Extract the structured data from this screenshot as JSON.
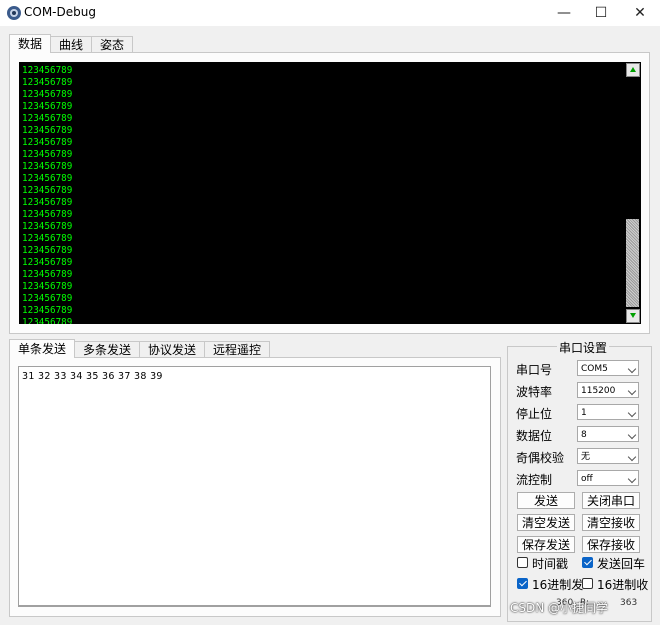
{
  "window": {
    "title": "COM-Debug",
    "minimize": "—",
    "maximize": "☐",
    "close": "✕"
  },
  "top_tabs": [
    "数据",
    "曲线",
    "姿态"
  ],
  "console": {
    "lines": [
      "123456789",
      "123456789",
      "123456789",
      "123456789",
      "123456789",
      "123456789",
      "123456789",
      "123456789",
      "123456789",
      "123456789",
      "123456789",
      "123456789",
      "123456789",
      "123456789",
      "123456789",
      "123456789",
      "123456789",
      "123456789",
      "123456789",
      "123456789",
      "123456789",
      "123456789"
    ]
  },
  "bottom_tabs": [
    "单条发送",
    "多条发送",
    "协议发送",
    "远程遥控"
  ],
  "send": {
    "text": "31 32 33 34 35 36 37 38 39"
  },
  "serial": {
    "title": "串口设置",
    "fields": [
      {
        "label": "串口号",
        "value": "COM5"
      },
      {
        "label": "波特率",
        "value": "115200"
      },
      {
        "label": "停止位",
        "value": "1"
      },
      {
        "label": "数据位",
        "value": "8"
      },
      {
        "label": "奇偶校验",
        "value": "无"
      },
      {
        "label": "流控制",
        "value": "off"
      }
    ],
    "buttons": {
      "send": "发送",
      "close_port": "关闭串口",
      "clear_send": "清空发送",
      "clear_recv": "清空接收",
      "save_send": "保存发送",
      "save_recv": "保存接收"
    },
    "checks": {
      "timestamp": "时间戳",
      "send_newline": "发送回车",
      "hex_send": "16进制发",
      "hex_recv": "16进制收"
    }
  },
  "status": {
    "tx": "360",
    "rx_label": "R:",
    "rx": "363"
  },
  "watermark": "CSDN @小捷同学",
  "colors": {
    "console_bg": "#000000",
    "console_text": "#00ff00",
    "check_on": "#0a64c8"
  }
}
